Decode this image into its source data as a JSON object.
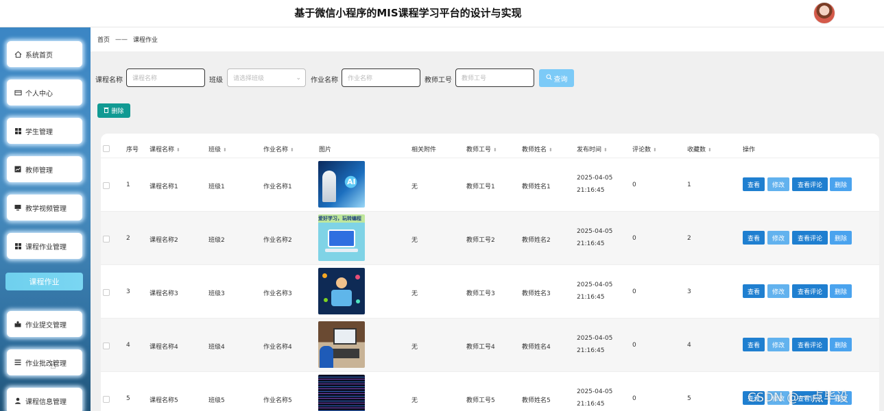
{
  "app": {
    "title": "基于微信小程序的MIS课程学习平台的设计与实现"
  },
  "sidebar": {
    "items": [
      {
        "label": "系统首页",
        "icon": "home-icon"
      },
      {
        "label": "个人中心",
        "icon": "card-icon"
      },
      {
        "label": "学生管理",
        "icon": "grid-icon"
      },
      {
        "label": "教师管理",
        "icon": "chart-icon"
      },
      {
        "label": "教学视频管理",
        "icon": "monitor-icon"
      },
      {
        "label": "课程作业管理",
        "icon": "grid-icon"
      },
      {
        "label": "作业提交管理",
        "icon": "upload-icon"
      },
      {
        "label": "作业批改管理",
        "icon": "list-icon"
      },
      {
        "label": "课程信息管理",
        "icon": "user-icon"
      }
    ],
    "active_sub": "课程作业"
  },
  "breadcrumb": {
    "home": "首页",
    "sep": "——",
    "current": "课程作业"
  },
  "filters": {
    "course_name": {
      "label": "课程名称",
      "placeholder": "课程名称"
    },
    "class": {
      "label": "班级",
      "placeholder": "请选择班级"
    },
    "homework_name": {
      "label": "作业名称",
      "placeholder": "作业名称"
    },
    "teacher_no": {
      "label": "教师工号",
      "placeholder": "教师工号"
    },
    "search_label": "查询"
  },
  "toolbar": {
    "delete_label": "删除"
  },
  "table": {
    "headers": [
      "序号",
      "课程名称",
      "班级",
      "作业名称",
      "图片",
      "相关附件",
      "教师工号",
      "教师姓名",
      "发布时间",
      "评论数",
      "收藏数",
      "操作"
    ],
    "rows": [
      {
        "no": "1",
        "course": "课程名称1",
        "class": "班级1",
        "homework": "作业名称1",
        "attach": "无",
        "tno": "教师工号1",
        "tname": "教师姓名1",
        "time": "2025-04-05 21:16:45",
        "comments": "0",
        "favs": "1"
      },
      {
        "no": "2",
        "course": "课程名称2",
        "class": "班级2",
        "homework": "作业名称2",
        "attach": "无",
        "tno": "教师工号2",
        "tname": "教师姓名2",
        "time": "2025-04-05 21:16:45",
        "comments": "0",
        "favs": "2"
      },
      {
        "no": "3",
        "course": "课程名称3",
        "class": "班级3",
        "homework": "作业名称3",
        "attach": "无",
        "tno": "教师工号3",
        "tname": "教师姓名3",
        "time": "2025-04-05 21:16:45",
        "comments": "0",
        "favs": "3"
      },
      {
        "no": "4",
        "course": "课程名称4",
        "class": "班级4",
        "homework": "作业名称4",
        "attach": "无",
        "tno": "教师工号4",
        "tname": "教师姓名4",
        "time": "2025-04-05 21:16:45",
        "comments": "0",
        "favs": "4"
      },
      {
        "no": "5",
        "course": "课程名称5",
        "class": "班级5",
        "homework": "作业名称5",
        "attach": "无",
        "tno": "教师工号5",
        "tname": "教师姓名5",
        "time": "2025-04-05 21:16:45",
        "comments": "0",
        "favs": "5"
      }
    ],
    "actions": {
      "view": "查看",
      "edit": "修改",
      "comments": "查看评论",
      "delete": "删除"
    },
    "thumb1_text": "AI",
    "thumb2_text": "爱好学习，玩转编程"
  },
  "watermark": "CSDN @一点毕设",
  "colors": {
    "sidebar": "#3b86c4",
    "accent": "#1f7fd0",
    "teal": "#119a93",
    "search": "#7ccaf7"
  }
}
